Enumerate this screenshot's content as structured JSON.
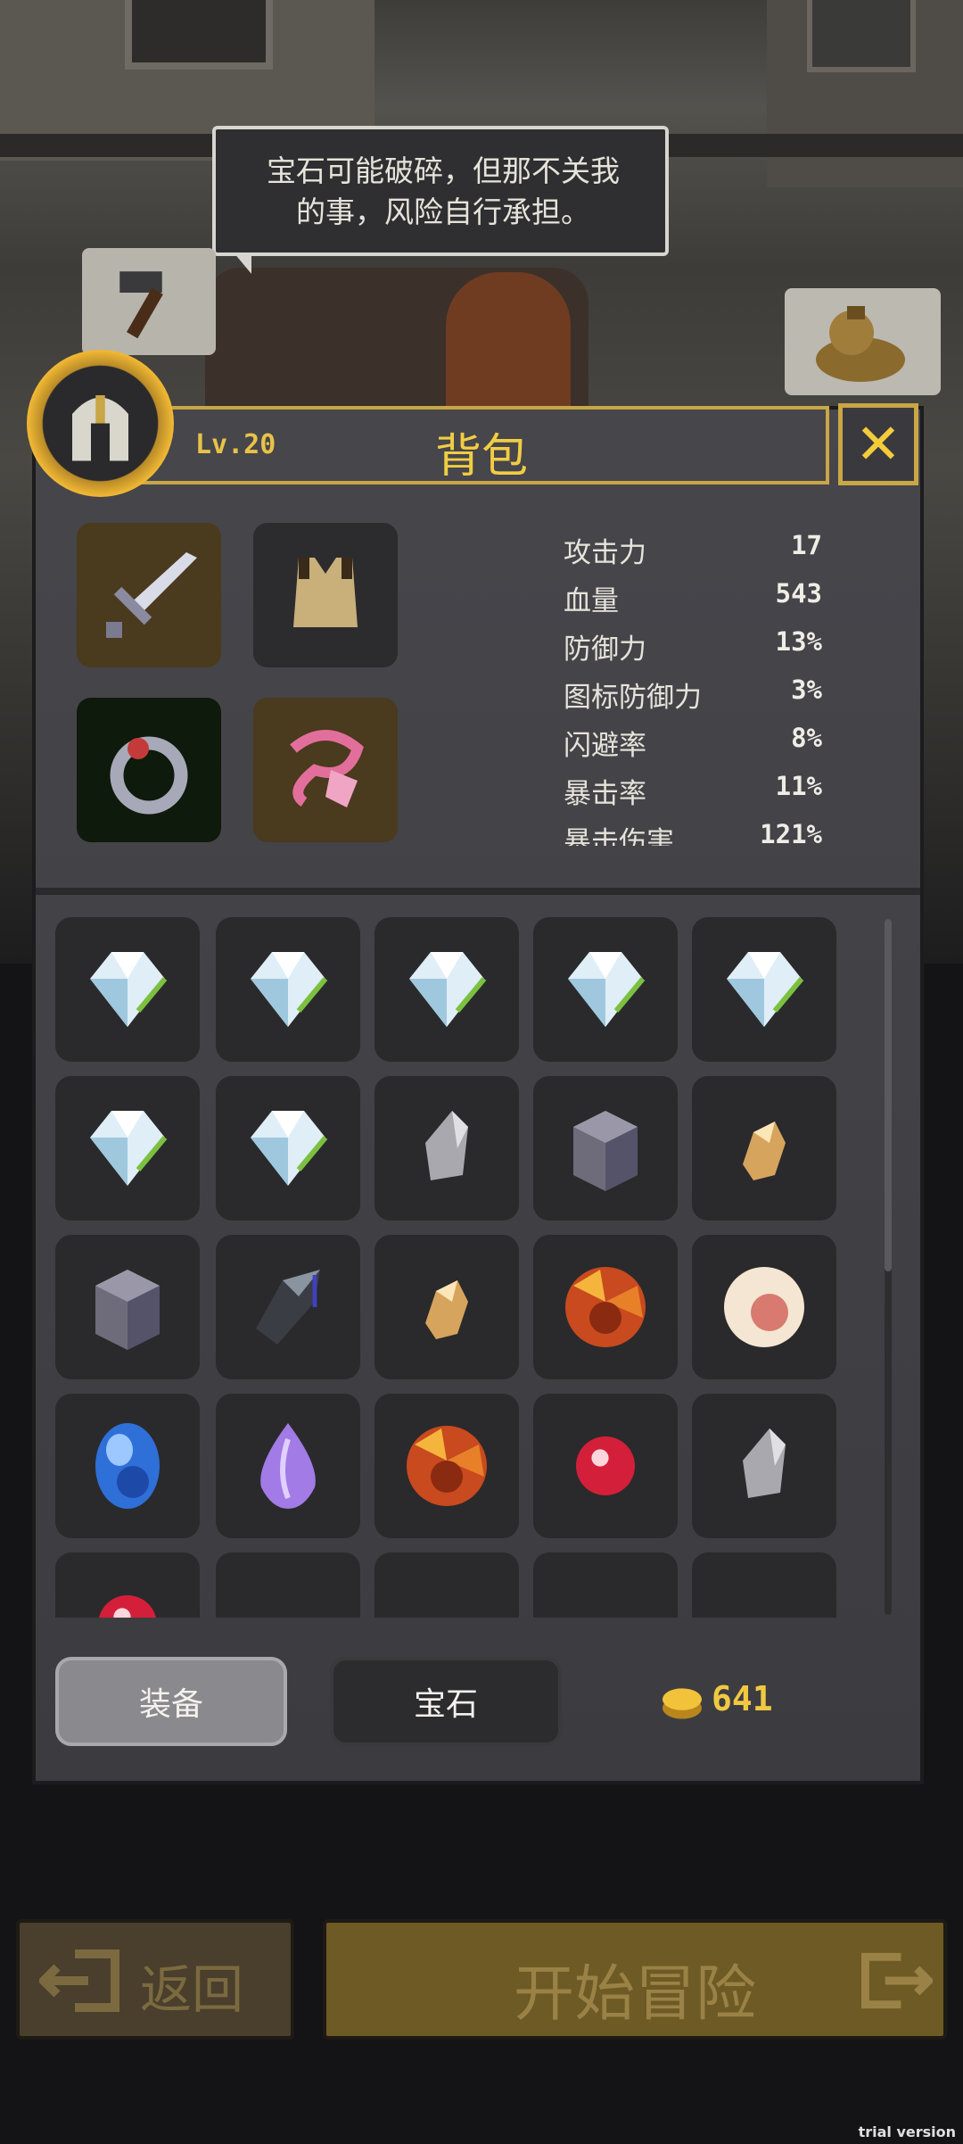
{
  "speech_bubble": {
    "line1": "宝石可能破碎，但那不关我",
    "line2": "的事，风险自行承担。"
  },
  "header": {
    "level": "Lv.20",
    "title": "背包",
    "close_icon": "close-x-icon"
  },
  "equipment": [
    {
      "slot": "weapon",
      "icon": "sword-icon"
    },
    {
      "slot": "armor",
      "icon": "leather-armor-icon"
    },
    {
      "slot": "ring",
      "icon": "ring-icon"
    },
    {
      "slot": "amulet",
      "icon": "pink-amulet-icon"
    }
  ],
  "stats": [
    {
      "label": "攻击力",
      "value": "17"
    },
    {
      "label": "血量",
      "value": "543"
    },
    {
      "label": "防御力",
      "value": "13%"
    },
    {
      "label": "图标防御力",
      "value": "3%"
    },
    {
      "label": "闪避率",
      "value": "8%"
    },
    {
      "label": "暴击率",
      "value": "11%"
    },
    {
      "label": "暴击伤害",
      "value": "121%"
    }
  ],
  "inventory": [
    [
      "diamond-icon",
      "diamond-icon",
      "diamond-icon",
      "diamond-icon",
      "diamond-icon"
    ],
    [
      "diamond-icon",
      "diamond-icon",
      "gray-shard-icon",
      "stone-cube-icon",
      "amber-shard-icon"
    ],
    [
      "stone-cube-icon",
      "obsidian-icon",
      "amber-shard-icon",
      "orange-gem-icon",
      "pearl-icon"
    ],
    [
      "sapphire-icon",
      "amethyst-icon",
      "orange-gem-icon",
      "ruby-icon",
      "gray-shard-icon"
    ],
    [
      "ruby-icon",
      "",
      "",
      "",
      ""
    ]
  ],
  "tabs": {
    "equip": "装备",
    "gem": "宝石"
  },
  "currency": {
    "coins": "641"
  },
  "buttons": {
    "back": "返回",
    "start": "开始冒险"
  },
  "watermark": "trial version"
}
